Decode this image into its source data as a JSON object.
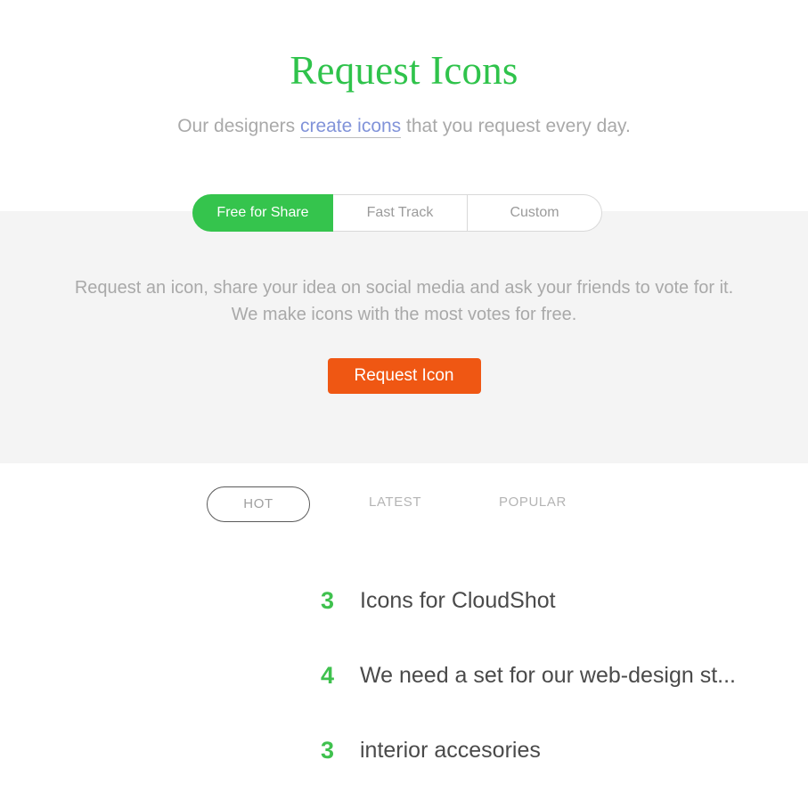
{
  "page": {
    "title": "Request Icons",
    "subtitle_before": "Our designers ",
    "subtitle_link": "create icons",
    "subtitle_after": " that you request every day."
  },
  "plan_tabs": {
    "items": [
      {
        "label": "Free for Share",
        "active": true
      },
      {
        "label": "Fast Track",
        "active": false
      },
      {
        "label": "Custom",
        "active": false
      }
    ]
  },
  "promo": {
    "line1": "Request an icon, share your idea on social media and ask your friends to vote for it.",
    "line2": "We make icons with the most votes for free.",
    "button_label": "Request Icon"
  },
  "filters": {
    "hot": "HOT",
    "latest": "LATEST",
    "popular": "POPULAR",
    "active": "HOT"
  },
  "requests": [
    {
      "votes": "3",
      "title": "Icons for CloudShot"
    },
    {
      "votes": "4",
      "title": "We need a set for our web-design st..."
    },
    {
      "votes": "3",
      "title": "interior accesories"
    }
  ],
  "colors": {
    "brand_green": "#2fc34b",
    "tab_green": "#35c44d",
    "accent_orange": "#ef5713",
    "link_blue": "#8193d9",
    "muted_gray": "#a9a9a9",
    "band_gray": "#f4f4f4",
    "title_dark": "#4a4a4a",
    "vote_green": "#3fc14e"
  }
}
